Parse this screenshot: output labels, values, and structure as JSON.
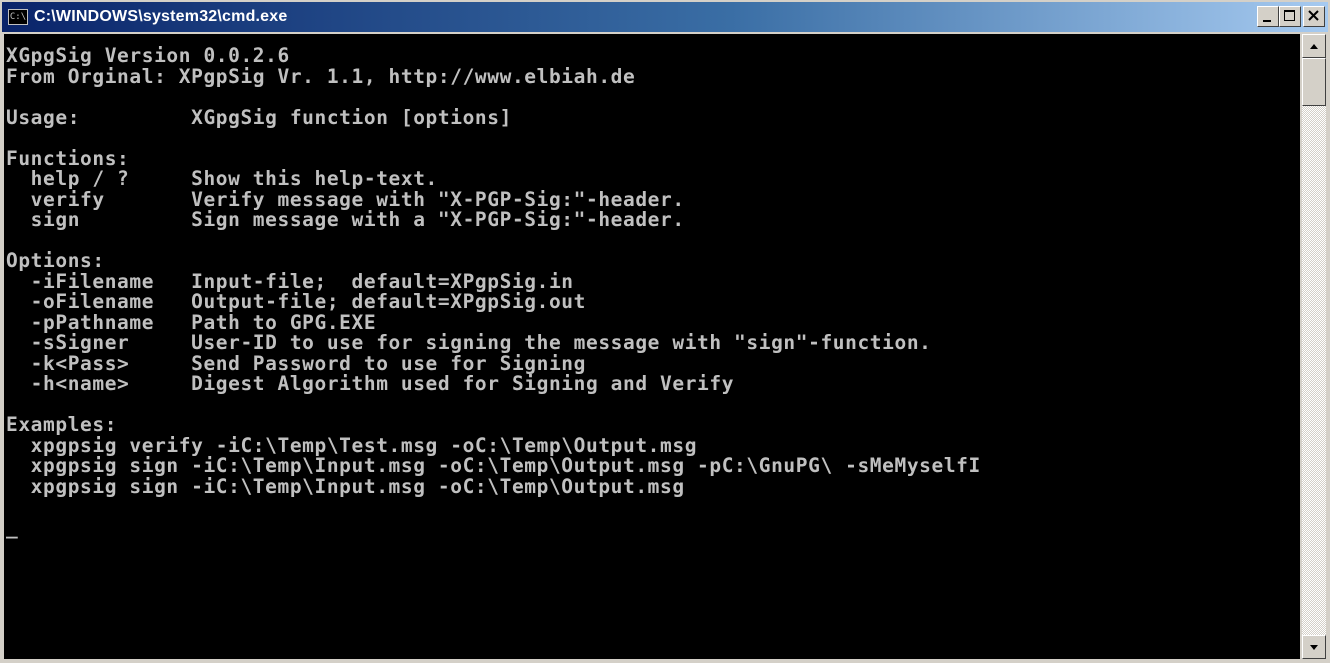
{
  "window": {
    "title": "C:\\WINDOWS\\system32\\cmd.exe",
    "icon_label": "C:\\",
    "buttons": [
      "minimize-icon",
      "maximize-icon",
      "close-icon"
    ]
  },
  "console": {
    "lines": [
      "XGpgSig Version 0.0.2.6",
      "From Orginal: XPgpSig Vr. 1.1, http://www.elbiah.de",
      "",
      "Usage:         XGpgSig function [options]",
      "",
      "Functions:",
      "  help / ?     Show this help-text.",
      "  verify       Verify message with \"X-PGP-Sig:\"-header.",
      "  sign         Sign message with a \"X-PGP-Sig:\"-header.",
      "",
      "Options:",
      "  -iFilename   Input-file;  default=XPgpSig.in",
      "  -oFilename   Output-file; default=XPgpSig.out",
      "  -pPathname   Path to GPG.EXE",
      "  -sSigner     User-ID to use for signing the message with \"sign\"-function.",
      "  -k<Pass>     Send Password to use for Signing",
      "  -h<name>     Digest Algorithm used for Signing and Verify",
      "",
      "Examples:",
      "  xpgpsig verify -iC:\\Temp\\Test.msg -oC:\\Temp\\Output.msg",
      "  xpgpsig sign -iC:\\Temp\\Input.msg -oC:\\Temp\\Output.msg -pC:\\GnuPG\\ -sMeMyselfI",
      "  xpgpsig sign -iC:\\Temp\\Input.msg -oC:\\Temp\\Output.msg",
      "",
      "_"
    ]
  },
  "colors": {
    "console_bg": "#000000",
    "console_fg": "#c0c0c0",
    "title_start": "#0a246a",
    "title_end": "#a6caf0",
    "chrome": "#d4d0c8"
  }
}
